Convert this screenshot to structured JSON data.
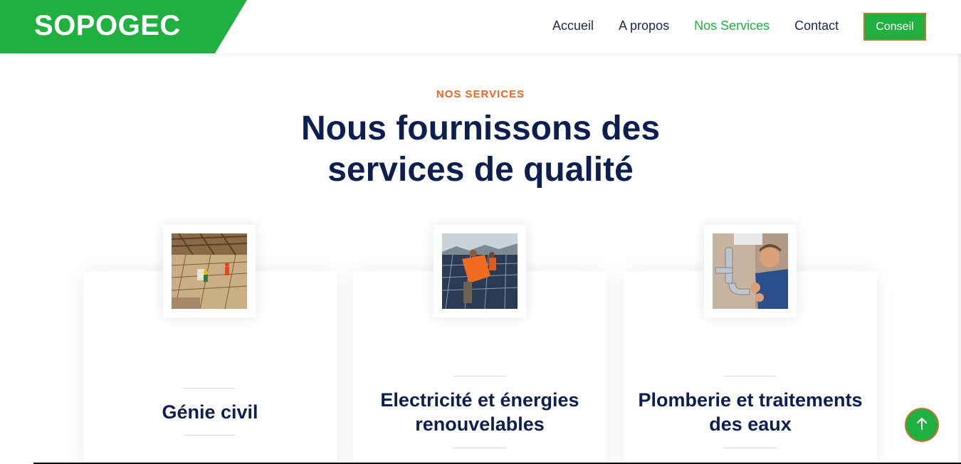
{
  "brand": {
    "name": "SOPOGEC",
    "color": "#1fb040"
  },
  "nav": {
    "links": [
      {
        "label": "Accueil",
        "active": false
      },
      {
        "label": "A propos",
        "active": false
      },
      {
        "label": "Nos Services",
        "active": true
      },
      {
        "label": "Contact",
        "active": false
      }
    ],
    "cta_label": "Conseil"
  },
  "section": {
    "eyebrow": "NOS SERVICES",
    "title": "Nous fournissons des services de qualité"
  },
  "services": [
    {
      "title": "Génie civil",
      "image": "construction-site-photo"
    },
    {
      "title": "Electricité et énergies renouvelables",
      "image": "solar-panel-installation-photo"
    },
    {
      "title": "Plomberie et traitements des eaux",
      "image": "plumber-photo"
    }
  ],
  "colors": {
    "accent": "#1fb040",
    "eyebrow": "#f0621f",
    "heading": "#0d1f4f",
    "cta_border": "#c4752b"
  },
  "scroll_top": {
    "icon": "arrow-up-icon"
  }
}
